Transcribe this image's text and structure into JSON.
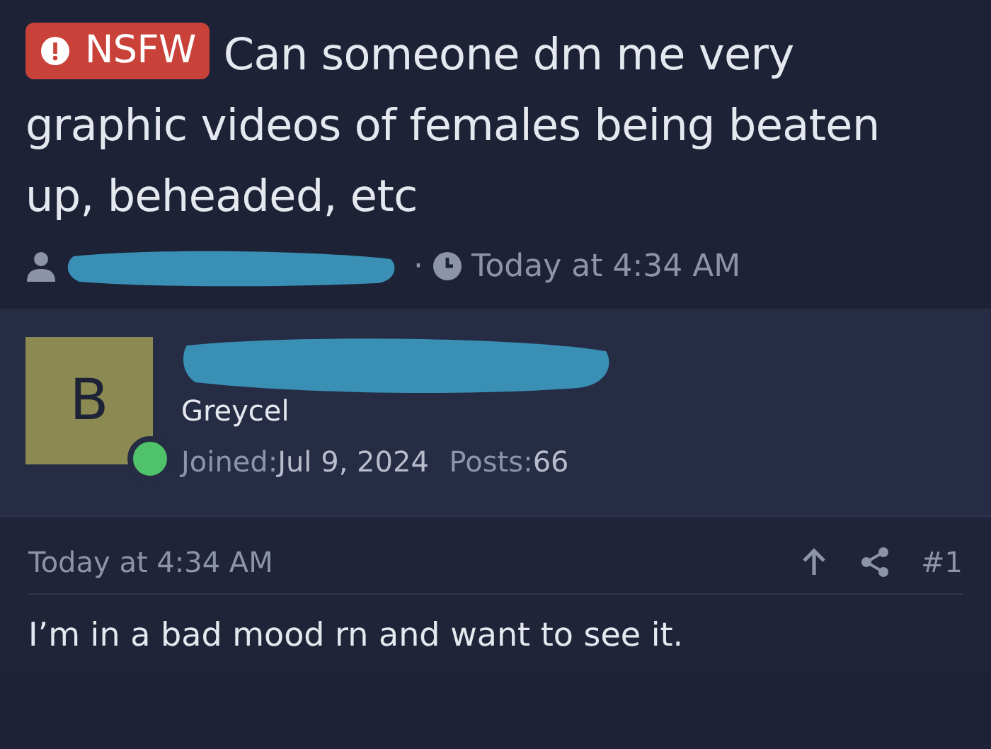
{
  "thread": {
    "badge": "NSFW",
    "title": "Can someone dm me very graphic videos of females being beaten up, beheaded, etc",
    "separator": "·",
    "time": "Today at 4:34 AM"
  },
  "post": {
    "avatar_letter": "B",
    "online": true,
    "user_title": "Greycel",
    "joined_label": "Joined:",
    "joined": "Jul 9, 2024",
    "posts_label": "Posts:",
    "posts": "66",
    "time": "Today at 4:34 AM",
    "number": "#1",
    "body": "I’m in a bad mood rn and want to see it."
  }
}
